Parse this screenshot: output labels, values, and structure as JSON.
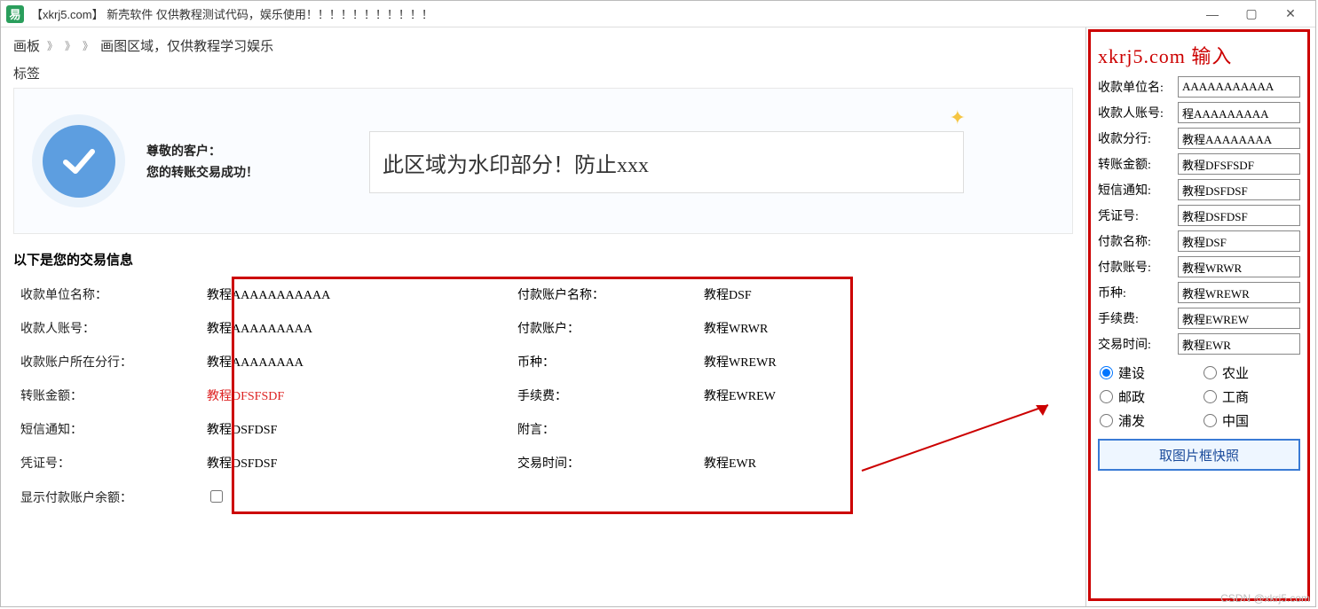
{
  "titlebar": {
    "icon_letter": "易",
    "title": "【xkrj5.com】 新壳软件 仅供教程测试代码，娱乐使用！！！！！！！！！！！"
  },
  "breadcrumb": {
    "root": "画板",
    "sep": "》",
    "leaf": "画图区域，仅供教程学习娱乐"
  },
  "tag_label": "标签",
  "banner": {
    "line1": "尊敬的客户：",
    "line2": "您的转账交易成功！",
    "watermark": "此区域为水印部分！防止xxx"
  },
  "transaction": {
    "heading": "以下是您的交易信息",
    "rows": [
      {
        "l1": "收款单位名称：",
        "v1": "教程AAAAAAAAAAA",
        "l2": "付款账户名称：",
        "v2": "教程DSF"
      },
      {
        "l1": "收款人账号：",
        "v1": "教程AAAAAAAAA",
        "l2": "付款账户：",
        "v2": "教程WRWR"
      },
      {
        "l1": "收款账户所在分行：",
        "v1": "教程AAAAAAAA",
        "l2": "币种：",
        "v2": "教程WREWR"
      },
      {
        "l1": "转账金额：",
        "v1": "教程DFSFSDF",
        "v1_red": true,
        "l2": "手续费：",
        "v2": "教程EWREW"
      },
      {
        "l1": "短信通知：",
        "v1": "教程DSFDSF",
        "l2": "附言：",
        "v2": ""
      },
      {
        "l1": "凭证号：",
        "v1": "教程DSFDSF",
        "l2": "交易时间：",
        "v2": "教程EWR"
      },
      {
        "l1": "显示付款账户余额：",
        "v1_checkbox": true,
        "l2": "",
        "v2": ""
      }
    ]
  },
  "right": {
    "title": "xkrj5.com 输入",
    "fields": [
      {
        "label": "收款单位名:",
        "value": "AAAAAAAAAAA"
      },
      {
        "label": "收款人账号:",
        "value": "程AAAAAAAAA"
      },
      {
        "label": "收款分行:",
        "value": "教程AAAAAAAA"
      },
      {
        "label": "转账金额:",
        "value": "教程DFSFSDF"
      },
      {
        "label": "短信通知:",
        "value": "教程DSFDSF"
      },
      {
        "label": "凭证号:",
        "value": "教程DSFDSF"
      },
      {
        "label": "付款名称:",
        "value": "教程DSF"
      },
      {
        "label": "付款账号:",
        "value": "教程WRWR"
      },
      {
        "label": "币种:",
        "value": "教程WREWR"
      },
      {
        "label": "手续费:",
        "value": "教程EWREW"
      },
      {
        "label": "交易时间:",
        "value": "教程EWR"
      }
    ],
    "radios": [
      {
        "label": "建设",
        "checked": true
      },
      {
        "label": "农业",
        "checked": false
      },
      {
        "label": "邮政",
        "checked": false
      },
      {
        "label": "工商",
        "checked": false
      },
      {
        "label": "浦发",
        "checked": false
      },
      {
        "label": "中国",
        "checked": false
      }
    ],
    "button": "取图片框快照"
  },
  "csdn": "CSDN @xkrj5.com"
}
